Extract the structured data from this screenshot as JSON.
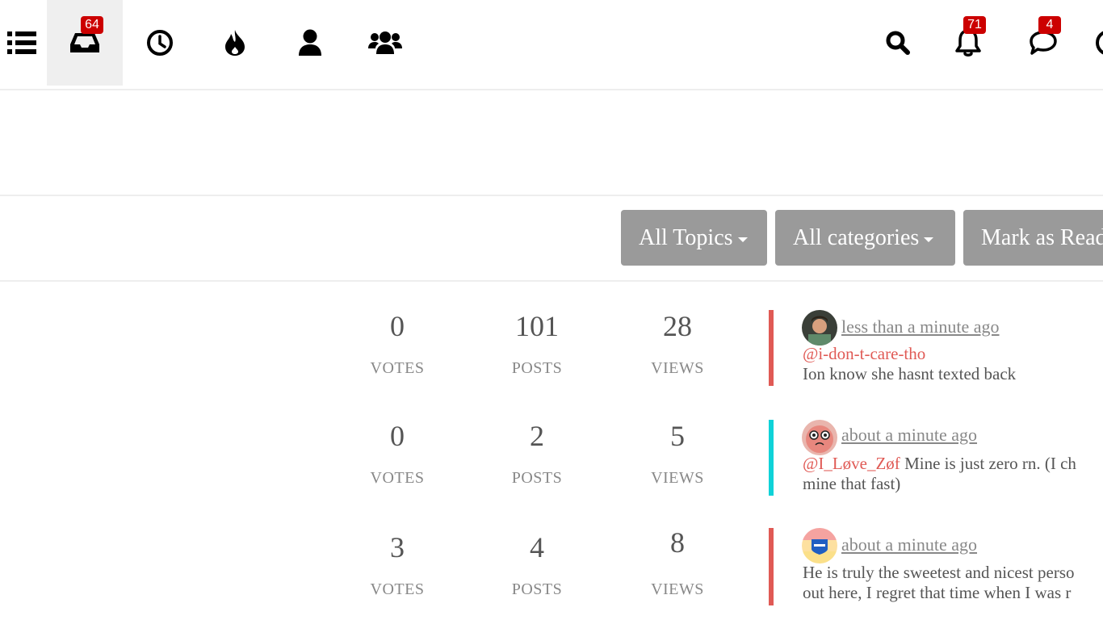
{
  "nav": {
    "badges": {
      "inbox": "64",
      "notifications": "71",
      "chats": "4"
    },
    "icons": [
      "menu-icon",
      "inbox-icon",
      "recent-icon",
      "popular-icon",
      "user-icon",
      "groups-icon",
      "search-icon",
      "bell-icon",
      "chat-icon"
    ]
  },
  "toolbar": {
    "topics": "All Topics",
    "categories": "All categories",
    "mark_read": "Mark as Read"
  },
  "topics": [
    {
      "votes": "0",
      "votes_label": "VOTES",
      "posts": "101",
      "posts_label": "POSTS",
      "views": "28",
      "views_label": "VIEWS",
      "bar_color": "#e05a55",
      "time": "less than a minute ago",
      "mention": "@i-don-t-care-tho",
      "line1_rest": "",
      "line2": "Ion know she hasnt texted back"
    },
    {
      "votes": "0",
      "votes_label": "VOTES",
      "posts": "2",
      "posts_label": "POSTS",
      "views": "5",
      "views_label": "VIEWS",
      "bar_color": "#0fd2d8",
      "time": "about a minute ago",
      "mention": "@I_Løve_Zøf",
      "line1_rest": " Mine is just zero rn. (I ch",
      "line2": "mine that fast)"
    },
    {
      "votes": "3",
      "votes_label": "VOTES",
      "posts": "4",
      "posts_label": "POSTS",
      "views": "8",
      "views_label": "VIEWS",
      "bar_color": "#e05a55",
      "time": "about a minute ago",
      "mention": "",
      "line1_rest": "He is truly the sweetest and nicest perso",
      "line2": "out here, I regret that time when I was r"
    }
  ],
  "colors": {
    "accent": "#c00",
    "button_bg": "#9a9a9a",
    "mention": "#e05a55"
  }
}
